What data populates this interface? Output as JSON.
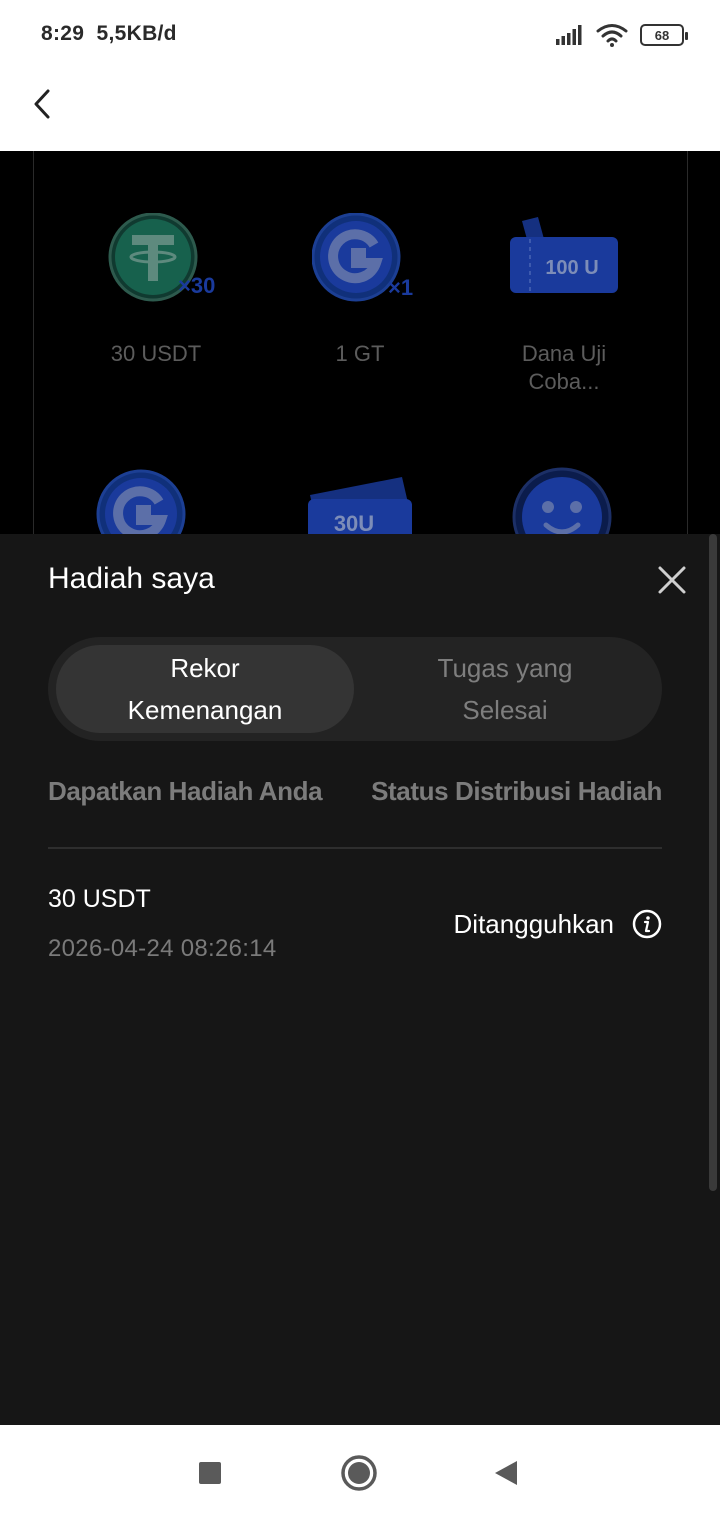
{
  "status_bar": {
    "time": "8:29",
    "speed": "5,5KB/d",
    "battery": "68",
    "icons": [
      "signal-icon",
      "wifi-icon",
      "battery-icon"
    ]
  },
  "header": {
    "back_icon": "chevron-left-icon"
  },
  "rewards_grid": {
    "items": [
      {
        "label": "30 USDT",
        "icon": "usdt-coin-icon",
        "badge": "×30"
      },
      {
        "label": "1 GT",
        "icon": "gt-coin-icon",
        "badge": "×1"
      },
      {
        "label": "Dana Uji Coba...",
        "icon": "voucher-icon",
        "badge": "100 U"
      },
      {
        "label": "",
        "icon": "gt-coin-icon",
        "badge": ""
      },
      {
        "label": "",
        "icon": "voucher-icon",
        "badge": "30U"
      },
      {
        "label": "",
        "icon": "smiley-icon",
        "badge": ""
      }
    ]
  },
  "sheet": {
    "title": "Hadiah saya",
    "tabs": [
      {
        "label": "Rekor Kemenangan",
        "active": true
      },
      {
        "label": "Tugas yang Selesai",
        "active": false
      }
    ],
    "columns": {
      "left": "Dapatkan Hadiah Anda",
      "right": "Status Distribusi Hadiah"
    },
    "records": [
      {
        "reward": "30 USDT",
        "date": "2026-04-24 08:26:14",
        "status": "Ditangguhkan"
      }
    ]
  },
  "nav_bar": {
    "icons": [
      "recent-apps-icon",
      "home-icon",
      "back-triangle-icon"
    ]
  },
  "colors": {
    "sheet_bg": "#161616",
    "tab_active_bg": "#343434",
    "accent_blue": "#1a3a9c",
    "usdt_green": "#17614d"
  }
}
